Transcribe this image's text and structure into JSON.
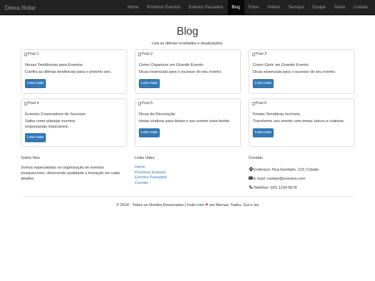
{
  "navbar": {
    "brand": "Deixa Rolar",
    "items": [
      {
        "label": "Home"
      },
      {
        "label": "Próximos Eventos"
      },
      {
        "label": "Eventos Passados"
      },
      {
        "label": "Blog"
      },
      {
        "label": "Fotos"
      },
      {
        "label": "Vídeos"
      },
      {
        "label": "Serviços"
      },
      {
        "label": "Equipe"
      },
      {
        "label": "Sobre"
      },
      {
        "label": "Contato"
      }
    ],
    "active": "Blog"
  },
  "header": {
    "title": "Blog",
    "subtitle": "Leia as últimas novidades e atualizações."
  },
  "posts": [
    {
      "image_alt": "Post 1",
      "title": "Novas Tendências para Eventos",
      "text": "Confira as últimas tendências para o próximo ano.",
      "button": "Leia mais"
    },
    {
      "image_alt": "Post 2",
      "title": "Como Organizar um Grande Evento",
      "text": "Dicas essenciais para o sucesso do seu evento.",
      "button": "Leia mais"
    },
    {
      "image_alt": "Post 3",
      "title": "Como Gerir um Grande Evento",
      "text": "Dicas essenciais para o sucesso do seu evento.",
      "button": "Leia mais"
    },
    {
      "image_alt": "Post 4",
      "title": "Eventos Corporativos de Sucesso",
      "text": "Saiba como planejar eventos empresariais impecáveis.",
      "button": "Leia mais"
    },
    {
      "image_alt": "Post 5",
      "title": "Dicas de Decoração",
      "text": "Ideias criativas para deixar o seu evento mais bonito.",
      "button": "Leia mais"
    },
    {
      "image_alt": "Post 6",
      "title": "Festas Temáticas Incríveis",
      "text": "Transforme seu evento com temas únicos e criativos.",
      "button": "Leia mais"
    }
  ],
  "footer": {
    "about": {
      "heading": "Sobre Nós",
      "text": "Somos especialistas na organização de eventos inesquecíveis, oferecendo qualidade e inovação em cada detalhe."
    },
    "links": {
      "heading": "Links Úteis",
      "items": [
        "Home",
        "Próximos Eventos",
        "Eventos Passados",
        "Contato"
      ]
    },
    "contact": {
      "heading": "Contato",
      "address": "Endereço: Rua Exemplo, 123, Cidade",
      "email": "E-mail: contato@eventos.com",
      "phone": "Telefone: (00) 1234-5678"
    },
    "copyright_prefix": "© 2024 - Todos os Direitos Reservados | Feito com",
    "copyright_suffix": "por Bernas, Tadeu, Gui e Isa"
  },
  "colors": {
    "navbar_bg": "#222222",
    "nav_text": "#9d9d9d",
    "button_primary": "#337ab7",
    "link": "#337ab7",
    "heart": "#e0245e"
  },
  "icons": {
    "address": "map-marker-icon",
    "email": "envelope-icon",
    "phone": "phone-icon",
    "heart": "heart-icon",
    "image": "broken-image-icon"
  }
}
